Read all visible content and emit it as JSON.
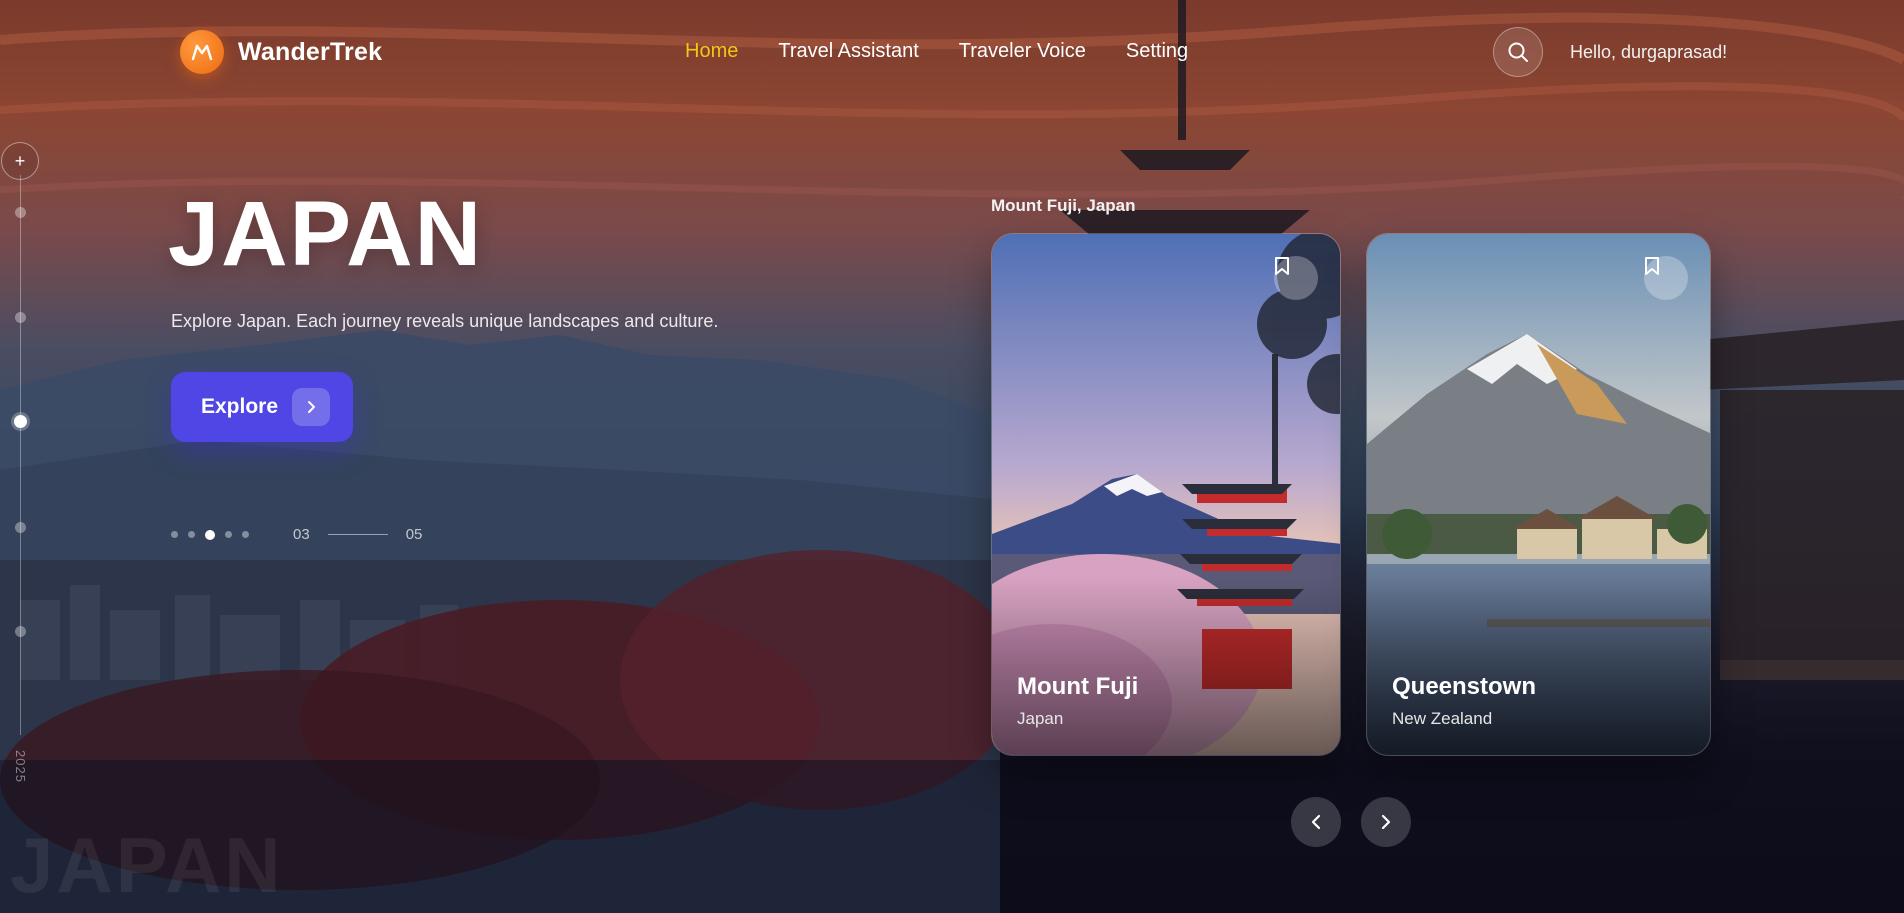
{
  "brand": {
    "name": "WanderTrek",
    "accent": "#ef6a12"
  },
  "nav": {
    "items": [
      {
        "label": "Home",
        "active": true
      },
      {
        "label": "Travel Assistant",
        "active": false
      },
      {
        "label": "Traveler Voice",
        "active": false
      },
      {
        "label": "Setting",
        "active": false
      }
    ],
    "active_color": "#f5c518"
  },
  "header": {
    "search_icon": "search-icon",
    "greeting": "Hello, durgaprasad!"
  },
  "rail": {
    "year": "2025",
    "plus": "+",
    "active_index": 2
  },
  "hero": {
    "title": "JAPAN",
    "subtitle": "Explore Japan. Each journey reveals unique landscapes and culture.",
    "cta_label": "Explore",
    "cta_color": "#4f46e5"
  },
  "pager": {
    "current": "03",
    "total": "05",
    "dots": 5,
    "active_dot": 2
  },
  "watermark": "JAPAN",
  "carousel": {
    "caption": "Mount Fuji, Japan",
    "cards": [
      {
        "name": "Mount Fuji",
        "country": "Japan"
      },
      {
        "name": "Queenstown",
        "country": "New Zealand"
      }
    ]
  }
}
